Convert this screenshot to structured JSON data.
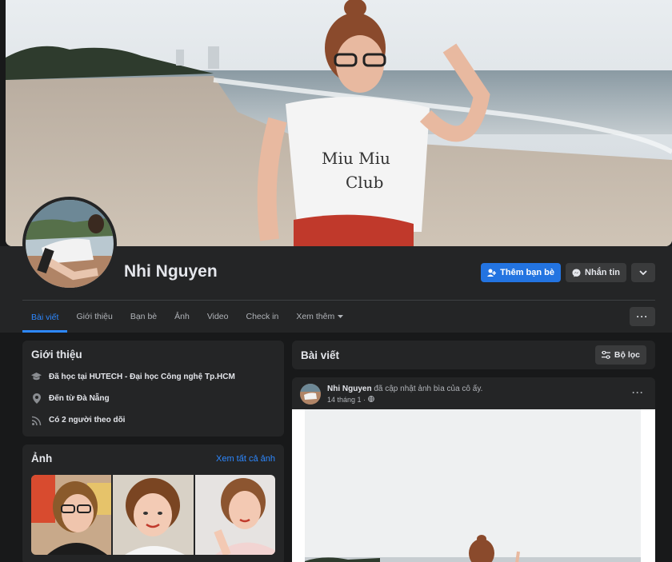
{
  "profile": {
    "name": "Nhi Nguyen"
  },
  "actions": {
    "add_friend": "Thêm bạn bè",
    "message": "Nhắn tin"
  },
  "tabs": [
    {
      "label": "Bài viết",
      "active": true
    },
    {
      "label": "Giới thiệu"
    },
    {
      "label": "Bạn bè"
    },
    {
      "label": "Ảnh"
    },
    {
      "label": "Video"
    },
    {
      "label": "Check in"
    },
    {
      "label": "Xem thêm"
    }
  ],
  "intro": {
    "title": "Giới thiệu",
    "items": [
      {
        "icon": "graduation-cap-icon",
        "text": "Đã học tại HUTECH - Đại học Công nghệ Tp.HCM"
      },
      {
        "icon": "location-pin-icon",
        "text": "Đến từ Đà Nẵng"
      },
      {
        "icon": "followers-icon",
        "text": "Có 2 người theo dõi"
      }
    ]
  },
  "photos": {
    "title": "Ảnh",
    "see_all": "Xem tất cả ảnh"
  },
  "posts": {
    "title": "Bài viết",
    "filter_label": "Bộ lọc"
  },
  "post": {
    "author": "Nhi Nguyen",
    "action": "đã cập nhật ảnh bìa của cô ấy.",
    "time": "14 tháng 1 ·"
  },
  "colors": {
    "accent": "#2d88ff",
    "primary_button": "#2374e1",
    "background": "#18191a",
    "card": "#242526"
  }
}
